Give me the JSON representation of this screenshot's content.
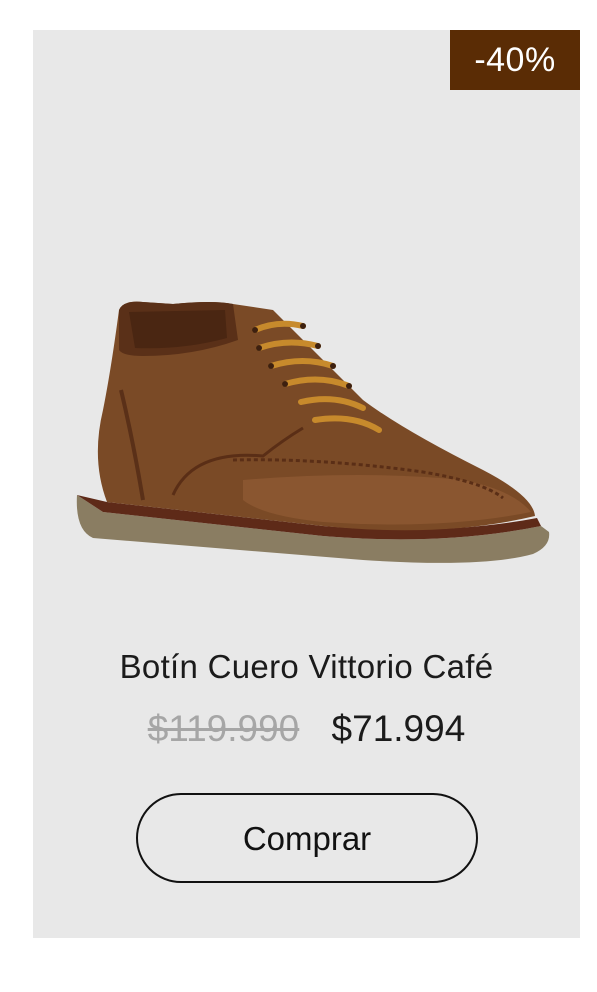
{
  "badge": {
    "discount": "-40%"
  },
  "product": {
    "title": "Botín Cuero Vittorio Café",
    "price_old": "$119.990",
    "price_new": "$71.994",
    "image_icon": "brown-leather-chukka-boot"
  },
  "actions": {
    "buy_label": "Comprar"
  },
  "colors": {
    "card_background": "#e8e8e8",
    "badge_background": "#5a2c05",
    "old_price": "#a6a6a6",
    "text": "#1b1b1b"
  }
}
